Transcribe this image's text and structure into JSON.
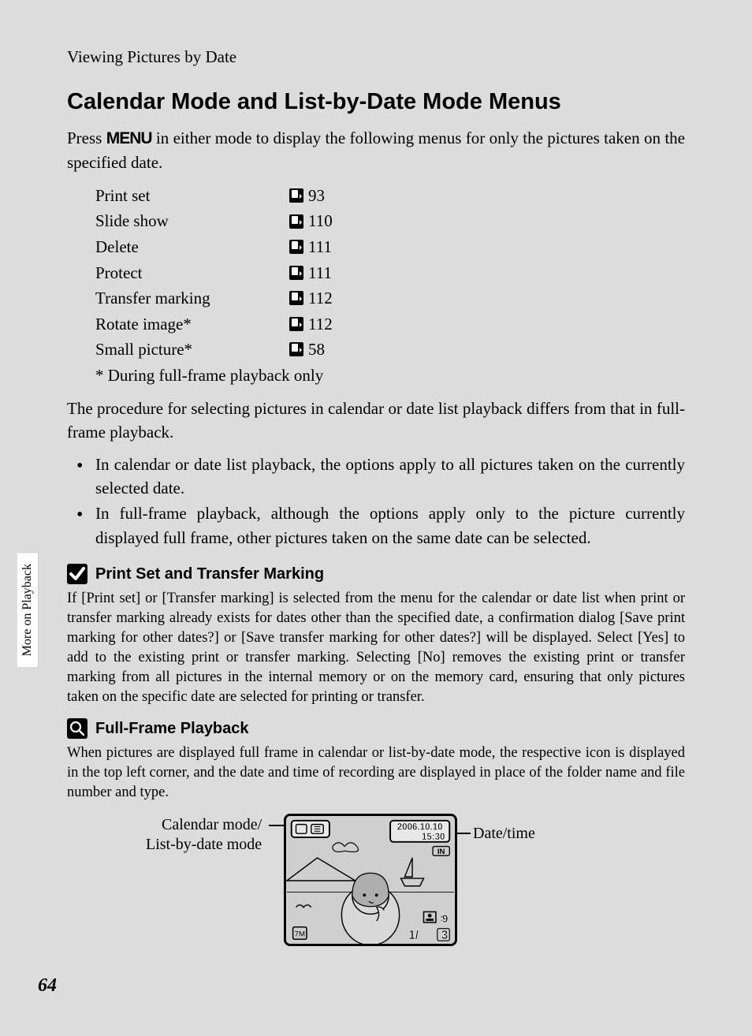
{
  "header": "Viewing Pictures by Date",
  "title": "Calendar Mode and List-by-Date Mode Menus",
  "intro_a": "Press ",
  "intro_menu": "MENU",
  "intro_b": " in either mode to display the following menus for only the pictures taken on the specified date.",
  "menu_items": [
    {
      "label": "Print set",
      "page": "93"
    },
    {
      "label": "Slide show",
      "page": "110"
    },
    {
      "label": "Delete",
      "page": "111"
    },
    {
      "label": "Protect",
      "page": "111"
    },
    {
      "label": "Transfer marking",
      "page": "112"
    },
    {
      "label": "Rotate image*",
      "page": "112"
    },
    {
      "label": "Small picture*",
      "page": "58"
    }
  ],
  "footnote": "* During full-frame playback only",
  "para2": "The procedure for selecting pictures in calendar or date list playback differs from that in full-frame playback.",
  "bullets": [
    "In calendar or date list playback, the options apply to all pictures taken on the currently selected date.",
    "In full-frame playback, although the options apply only to the picture currently displayed full frame, other pictures taken on the same date can be selected."
  ],
  "note1_title": "Print Set and Transfer Marking",
  "note1_body": "If [Print set] or [Transfer marking] is selected from the menu for the calendar or date list when print or transfer marking already exists for dates other than the specified date, a confirmation dialog [Save print marking for other dates?] or [Save transfer marking for other dates?] will be displayed. Select [Yes] to add to the existing print or transfer marking. Selecting [No] removes the existing print or transfer marking from all pictures in the internal memory or on the memory card, ensuring that only pictures taken on the specific date are selected for printing or transfer.",
  "note2_title": "Full-Frame Playback",
  "note2_body": "When pictures are displayed full frame in calendar or list-by-date mode, the respective icon is displayed in the top left corner, and the date and time of recording are displayed in place of the folder name and file number and type.",
  "ill_label_left_a": "Calendar mode/",
  "ill_label_left_b": "List-by-date mode",
  "ill_label_right": "Date/time",
  "screen_date": "2006.10.10",
  "screen_time": "15:30",
  "screen_in": "IN",
  "screen_counter": "1/",
  "screen_total": "3",
  "side_tab": "More on Playback",
  "page_number": "64"
}
